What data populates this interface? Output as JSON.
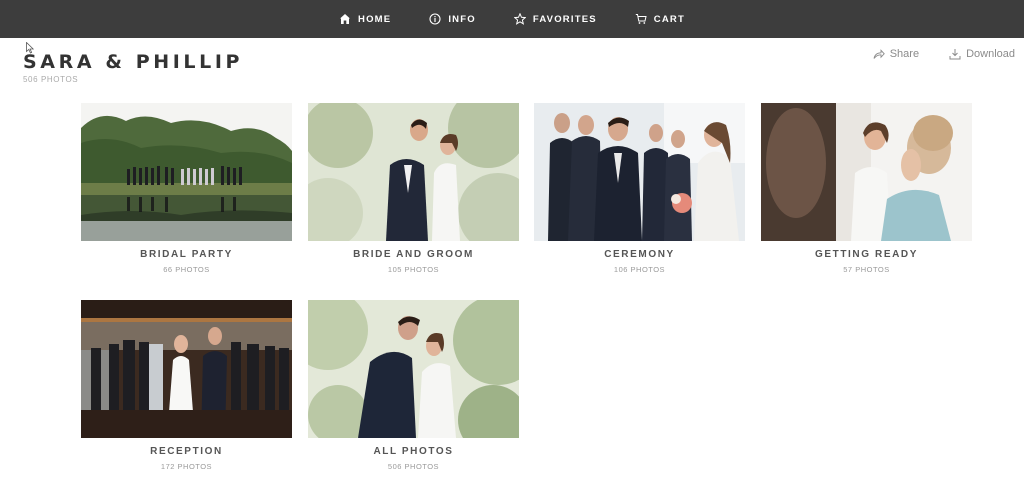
{
  "nav": {
    "items": [
      {
        "label": "HOME",
        "icon": "home-icon"
      },
      {
        "label": "INFO",
        "icon": "info-icon"
      },
      {
        "label": "FAVORITES",
        "icon": "star-icon"
      },
      {
        "label": "CART",
        "icon": "cart-icon"
      }
    ]
  },
  "album": {
    "title": "SARA & PHILLIP",
    "count": "506 PHOTOS"
  },
  "actions": {
    "share": "Share",
    "download": "Download"
  },
  "collections": [
    {
      "title": "BRIDAL PARTY",
      "count": "66 PHOTOS"
    },
    {
      "title": "BRIDE AND GROOM",
      "count": "105 PHOTOS"
    },
    {
      "title": "CEREMONY",
      "count": "106 PHOTOS"
    },
    {
      "title": "GETTING READY",
      "count": "57 PHOTOS"
    },
    {
      "title": "RECEPTION",
      "count": "172 PHOTOS"
    },
    {
      "title": "ALL PHOTOS",
      "count": "506 PHOTOS"
    }
  ],
  "colors": {
    "nav_bg": "#3d3d3d",
    "title": "#333333",
    "muted": "#9a9a9a"
  }
}
